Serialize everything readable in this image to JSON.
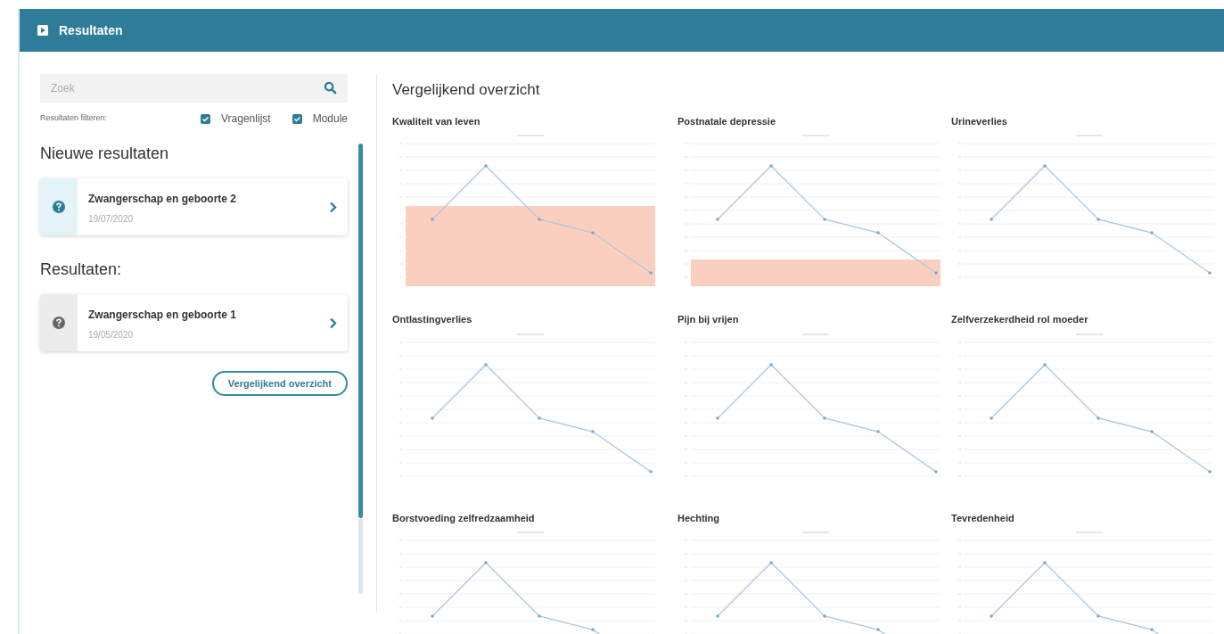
{
  "header": {
    "title": "Resultaten"
  },
  "search": {
    "placeholder": "Zoek"
  },
  "filter": {
    "label": "Resultaten filteren:",
    "options": [
      {
        "label": "Vragenlijst",
        "checked": true
      },
      {
        "label": "Module",
        "checked": true
      }
    ]
  },
  "sections": [
    {
      "title": "Nieuwe resultaten",
      "items": [
        {
          "title": "Zwangerschap en geboorte 2",
          "date": "19/07/2020",
          "kind": "new"
        }
      ]
    },
    {
      "title": "Resultaten:",
      "items": [
        {
          "title": "Zwangerschap en geboorte 1",
          "date": "19/05/2020",
          "kind": "old"
        }
      ]
    }
  ],
  "compare_button": "Vergelijkend overzicht",
  "overview": {
    "title": "Vergelijkend overzicht",
    "charts": [
      {
        "title": "Kwaliteit van leven",
        "kind": "wideband"
      },
      {
        "title": "Postnatale depressie",
        "kind": "narrowband"
      },
      {
        "title": "Urineverlies",
        "kind": "plain"
      },
      {
        "title": "Ontlastingverlies",
        "kind": "plain"
      },
      {
        "title": "Pijn bij vrijen",
        "kind": "plain"
      },
      {
        "title": "Zelfverzekerdheid rol moeder",
        "kind": "plain"
      },
      {
        "title": "Borstvoeding zelfredzaamheid",
        "kind": "plain"
      },
      {
        "title": "Hechting",
        "kind": "plain"
      },
      {
        "title": "Tevredenheid",
        "kind": "plain"
      }
    ]
  }
}
